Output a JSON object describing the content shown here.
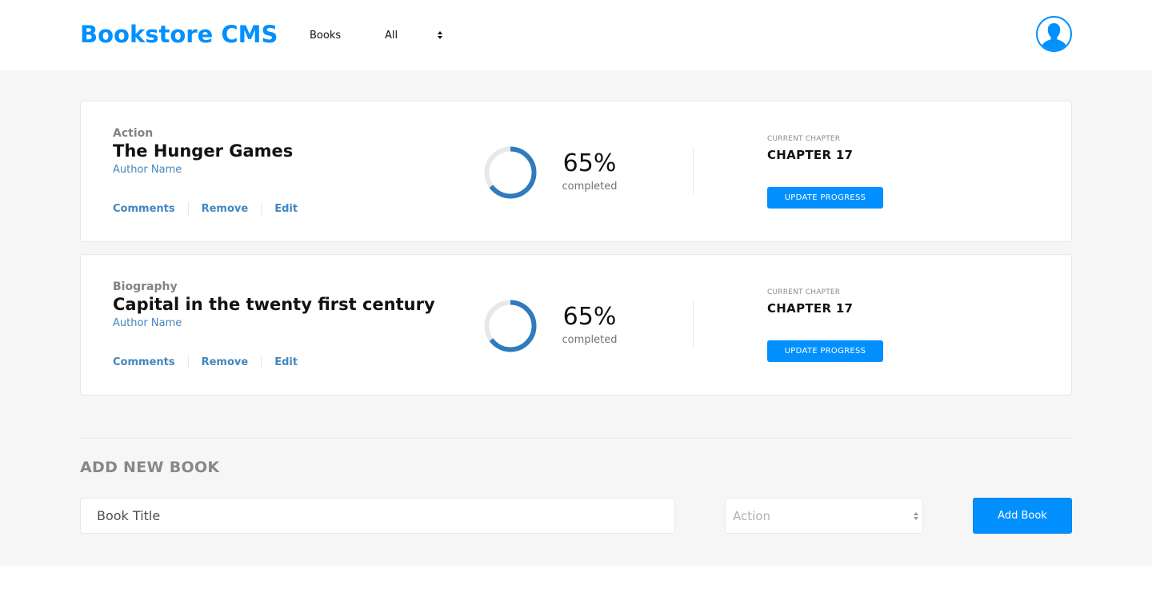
{
  "header": {
    "logo": "Bookstore CMS",
    "nav_books": "Books",
    "filter_value": "All"
  },
  "books": [
    {
      "genre": "Action",
      "title": "The Hunger Games",
      "author": "Author Name",
      "actions": [
        "Comments",
        "Remove",
        "Edit"
      ],
      "progress_percent": 65,
      "percent_label": "65%",
      "completed_label": "completed",
      "chapter_label": "CURRENT CHAPTER",
      "chapter_value": "CHAPTER 17",
      "update_label": "UPDATE PROGRESS"
    },
    {
      "genre": "Biography",
      "title": "Capital in the twenty first century",
      "author": "Author Name",
      "actions": [
        "Comments",
        "Remove",
        "Edit"
      ],
      "progress_percent": 65,
      "percent_label": "65%",
      "completed_label": "completed",
      "chapter_label": "CURRENT CHAPTER",
      "chapter_value": "CHAPTER 17",
      "update_label": "UPDATE PROGRESS"
    }
  ],
  "add_book": {
    "heading": "ADD NEW BOOK",
    "title_placeholder": "Book Title",
    "category_value": "Action",
    "button_label": "Add Book"
  },
  "colors": {
    "accent": "#0290ff",
    "link": "#4386bf",
    "ring_track": "#e8e8e8",
    "page_bg": "#f6f6f6"
  },
  "icons": {
    "avatar": "user-silhouette-icon",
    "select_arrows": "sort-arrows-icon"
  }
}
